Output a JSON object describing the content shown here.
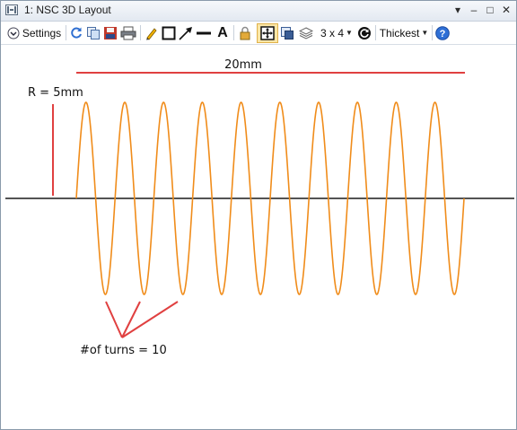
{
  "window": {
    "title": "1: NSC 3D Layout",
    "controls": {
      "menu": "▾",
      "pin": "▾",
      "minimize": "–",
      "maximize": "□",
      "close": "✕"
    }
  },
  "toolbar": {
    "settings_label": "Settings",
    "tools": [
      "refresh-icon",
      "copy-icon",
      "save-icon",
      "print-icon",
      "pencil-icon",
      "rectangle-icon",
      "arrow-icon",
      "line-icon",
      "text-icon",
      "lock-icon",
      "fit-icon",
      "export-icon",
      "layers-icon",
      "rotate-icon",
      "help-icon"
    ],
    "text_tool_label": "A",
    "layout_value": "3 x 4",
    "thickness_value": "Thickest"
  },
  "canvas": {
    "annotations": {
      "length_label": "20mm",
      "radius_label": "R = 5mm",
      "turns_label": "#of turns = 10"
    },
    "helix": {
      "turns": 10,
      "color": "#f08c1a"
    },
    "colors": {
      "axis": "#1a1a1a",
      "annotation": "#e04040"
    }
  }
}
